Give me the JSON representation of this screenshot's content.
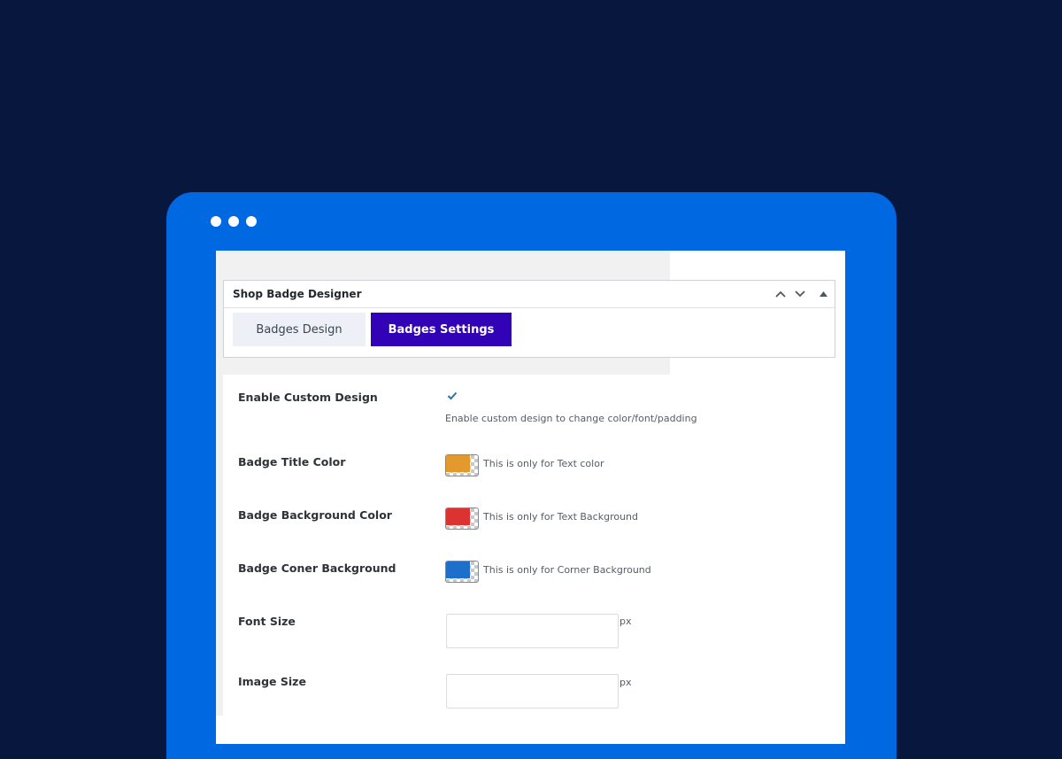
{
  "metabox": {
    "title": "Shop Badge Designer"
  },
  "tabs": [
    {
      "label": "Badges Design",
      "active": false
    },
    {
      "label": "Badges Settings",
      "active": true
    }
  ],
  "settings": {
    "enable_custom_design": {
      "label": "Enable Custom Design",
      "checked": true,
      "description": "Enable custom design to change color/font/padding"
    },
    "title_color": {
      "label": "Badge Title Color",
      "color": "#e39a2d",
      "note": "This is only for Text color"
    },
    "background_color": {
      "label": "Badge Background Color",
      "color": "#dd3232",
      "note": "This is only for Text Background"
    },
    "corner_background": {
      "label": "Badge Coner Background",
      "color": "#1e6fc9",
      "note": "This is only for Corner Background"
    },
    "font_size": {
      "label": "Font Size",
      "value": "",
      "unit": "px"
    },
    "image_size": {
      "label": "Image Size",
      "value": "",
      "unit": "px"
    }
  },
  "colors": {
    "background": "#07173d",
    "frame": "#0068e0",
    "active_tab": "#3203b6",
    "inactive_tab": "#eef0f8",
    "checkmark": "#2271b1"
  }
}
